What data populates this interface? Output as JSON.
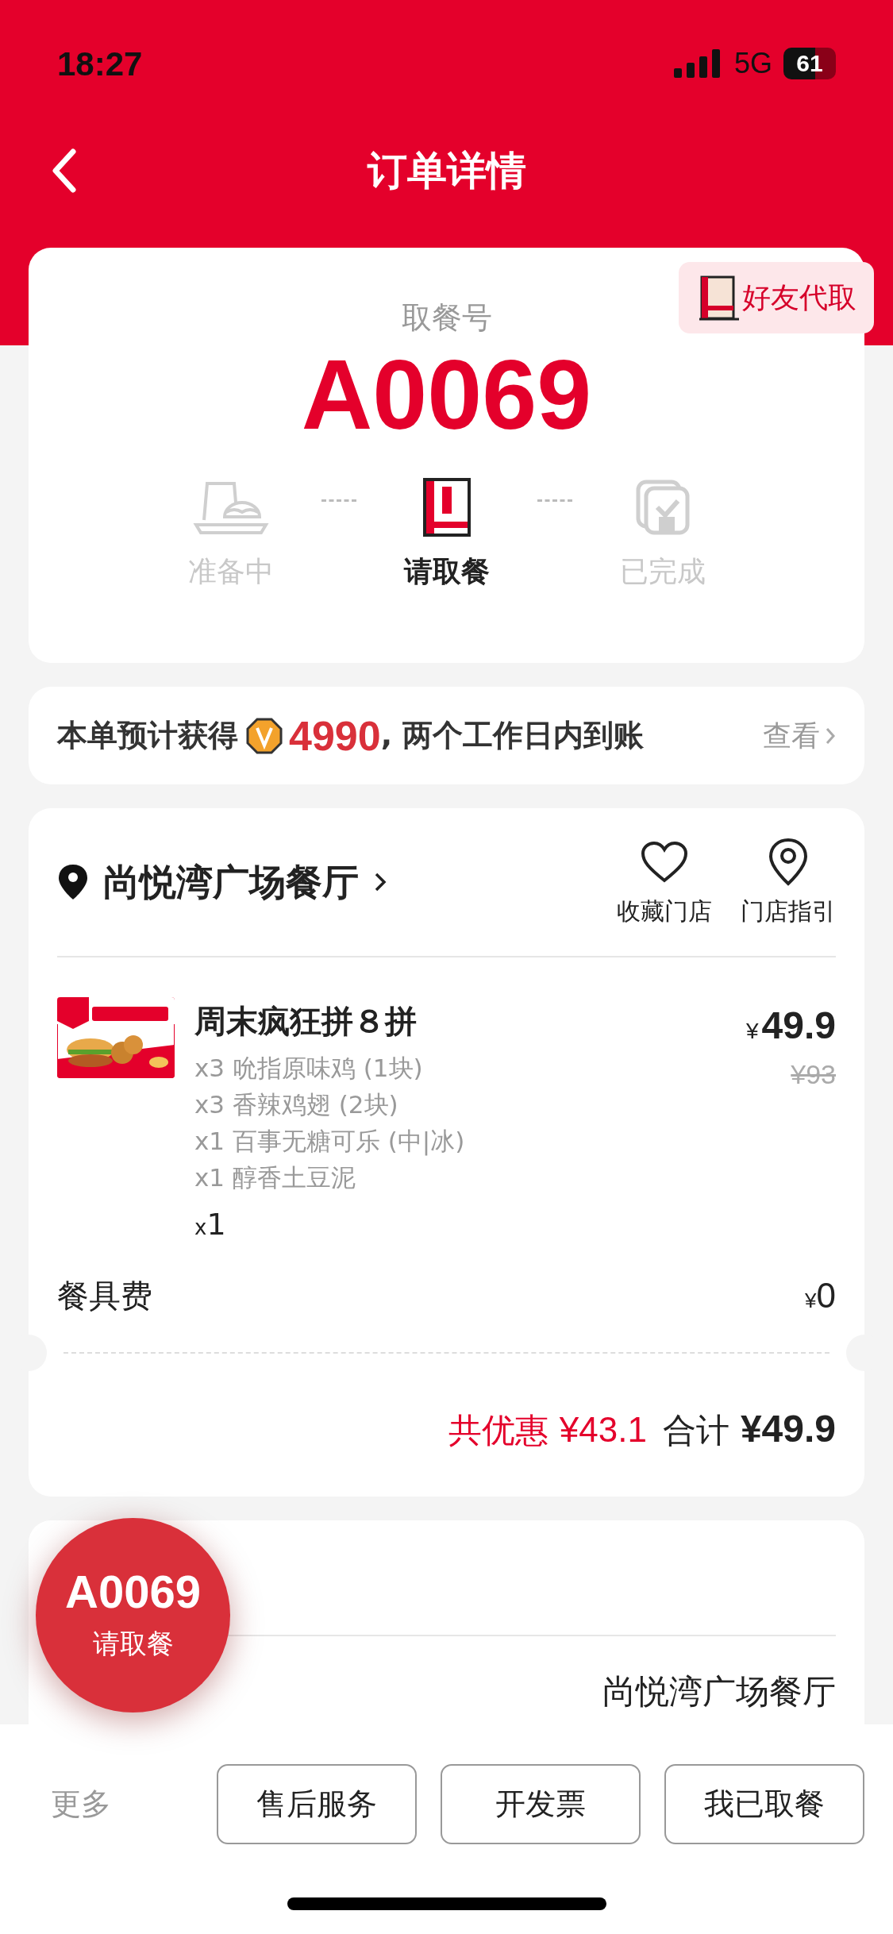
{
  "status_bar": {
    "time": "18:27",
    "network": "5G",
    "battery": "61"
  },
  "header": {
    "title": "订单详情"
  },
  "pickup": {
    "label": "取餐号",
    "number": "A0069",
    "friend_pickup": "好友代取",
    "steps": [
      {
        "label": "准备中",
        "kind": "prepare",
        "current": false
      },
      {
        "label": "请取餐",
        "kind": "pickup",
        "current": true
      },
      {
        "label": "已完成",
        "kind": "done",
        "current": false
      }
    ]
  },
  "points": {
    "prefix": "本单预计获得",
    "amount": "4990",
    "suffix": ", 两个工作日内到账",
    "link": "查看"
  },
  "store": {
    "name": "尚悦湾广场餐厅",
    "actions": [
      {
        "label": "收藏门店",
        "kind": "heart"
      },
      {
        "label": "门店指引",
        "kind": "pin"
      }
    ]
  },
  "items": [
    {
      "kind": "picture",
      "name": "周末疯狂拼８拼",
      "details": [
        "x3 吮指原味鸡 (1块)",
        "x3 香辣鸡翅 (2块)",
        "x1 百事无糖可乐 (中|冰)",
        "x1 醇香土豆泥"
      ],
      "quantity_prefix": "x",
      "quantity": "1",
      "currency": "¥",
      "price": "49.9",
      "original_price": "¥93"
    }
  ],
  "fees": [
    {
      "label": "餐具费",
      "currency": "¥",
      "amount": "0"
    }
  ],
  "summary": {
    "discount_label": "共优惠",
    "discount": "¥43.1",
    "total_label": "合计",
    "total": "¥49.9"
  },
  "info": {
    "rows": [
      {
        "value": "尚悦湾广场餐厅"
      }
    ]
  },
  "float_badge": {
    "number": "A0069",
    "label": "请取餐"
  },
  "footer": {
    "more": "更多",
    "buttons": [
      "售后服务",
      "开发票",
      "我已取餐"
    ]
  }
}
